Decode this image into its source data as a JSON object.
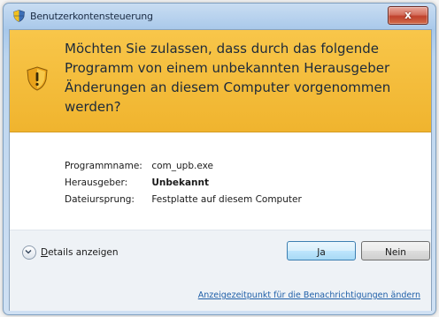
{
  "window": {
    "title": "Benutzerkontensteuerung",
    "close_symbol": "x"
  },
  "banner": {
    "headline": "Möchten Sie zulassen, dass durch das folgende Programm von einem unbekannten Herausgeber Änderungen an diesem Computer vorgenommen werden?"
  },
  "details": [
    {
      "label": "Programmname:",
      "value": "com_upb.exe"
    },
    {
      "label": "Herausgeber:",
      "value": "Unbekannt"
    },
    {
      "label": "Dateiursprung:",
      "value": "Festplatte auf diesem Computer"
    }
  ],
  "footer": {
    "details_toggle_label_hotkey": "D",
    "details_toggle_label_rest": "etails anzeigen",
    "yes_label": "Ja",
    "no_label": "Nein",
    "notification_link": "Anzeigezeitpunkt für die Benachrichtigungen ändern"
  },
  "icons": {
    "title_icon": "uac-shield-icon",
    "banner_icon": "warning-shield-icon",
    "toggle_icon": "chevron-down-icon"
  },
  "colors": {
    "banner": "#f0b42e",
    "link": "#1f5fa8",
    "close_button": "#c0412c"
  }
}
